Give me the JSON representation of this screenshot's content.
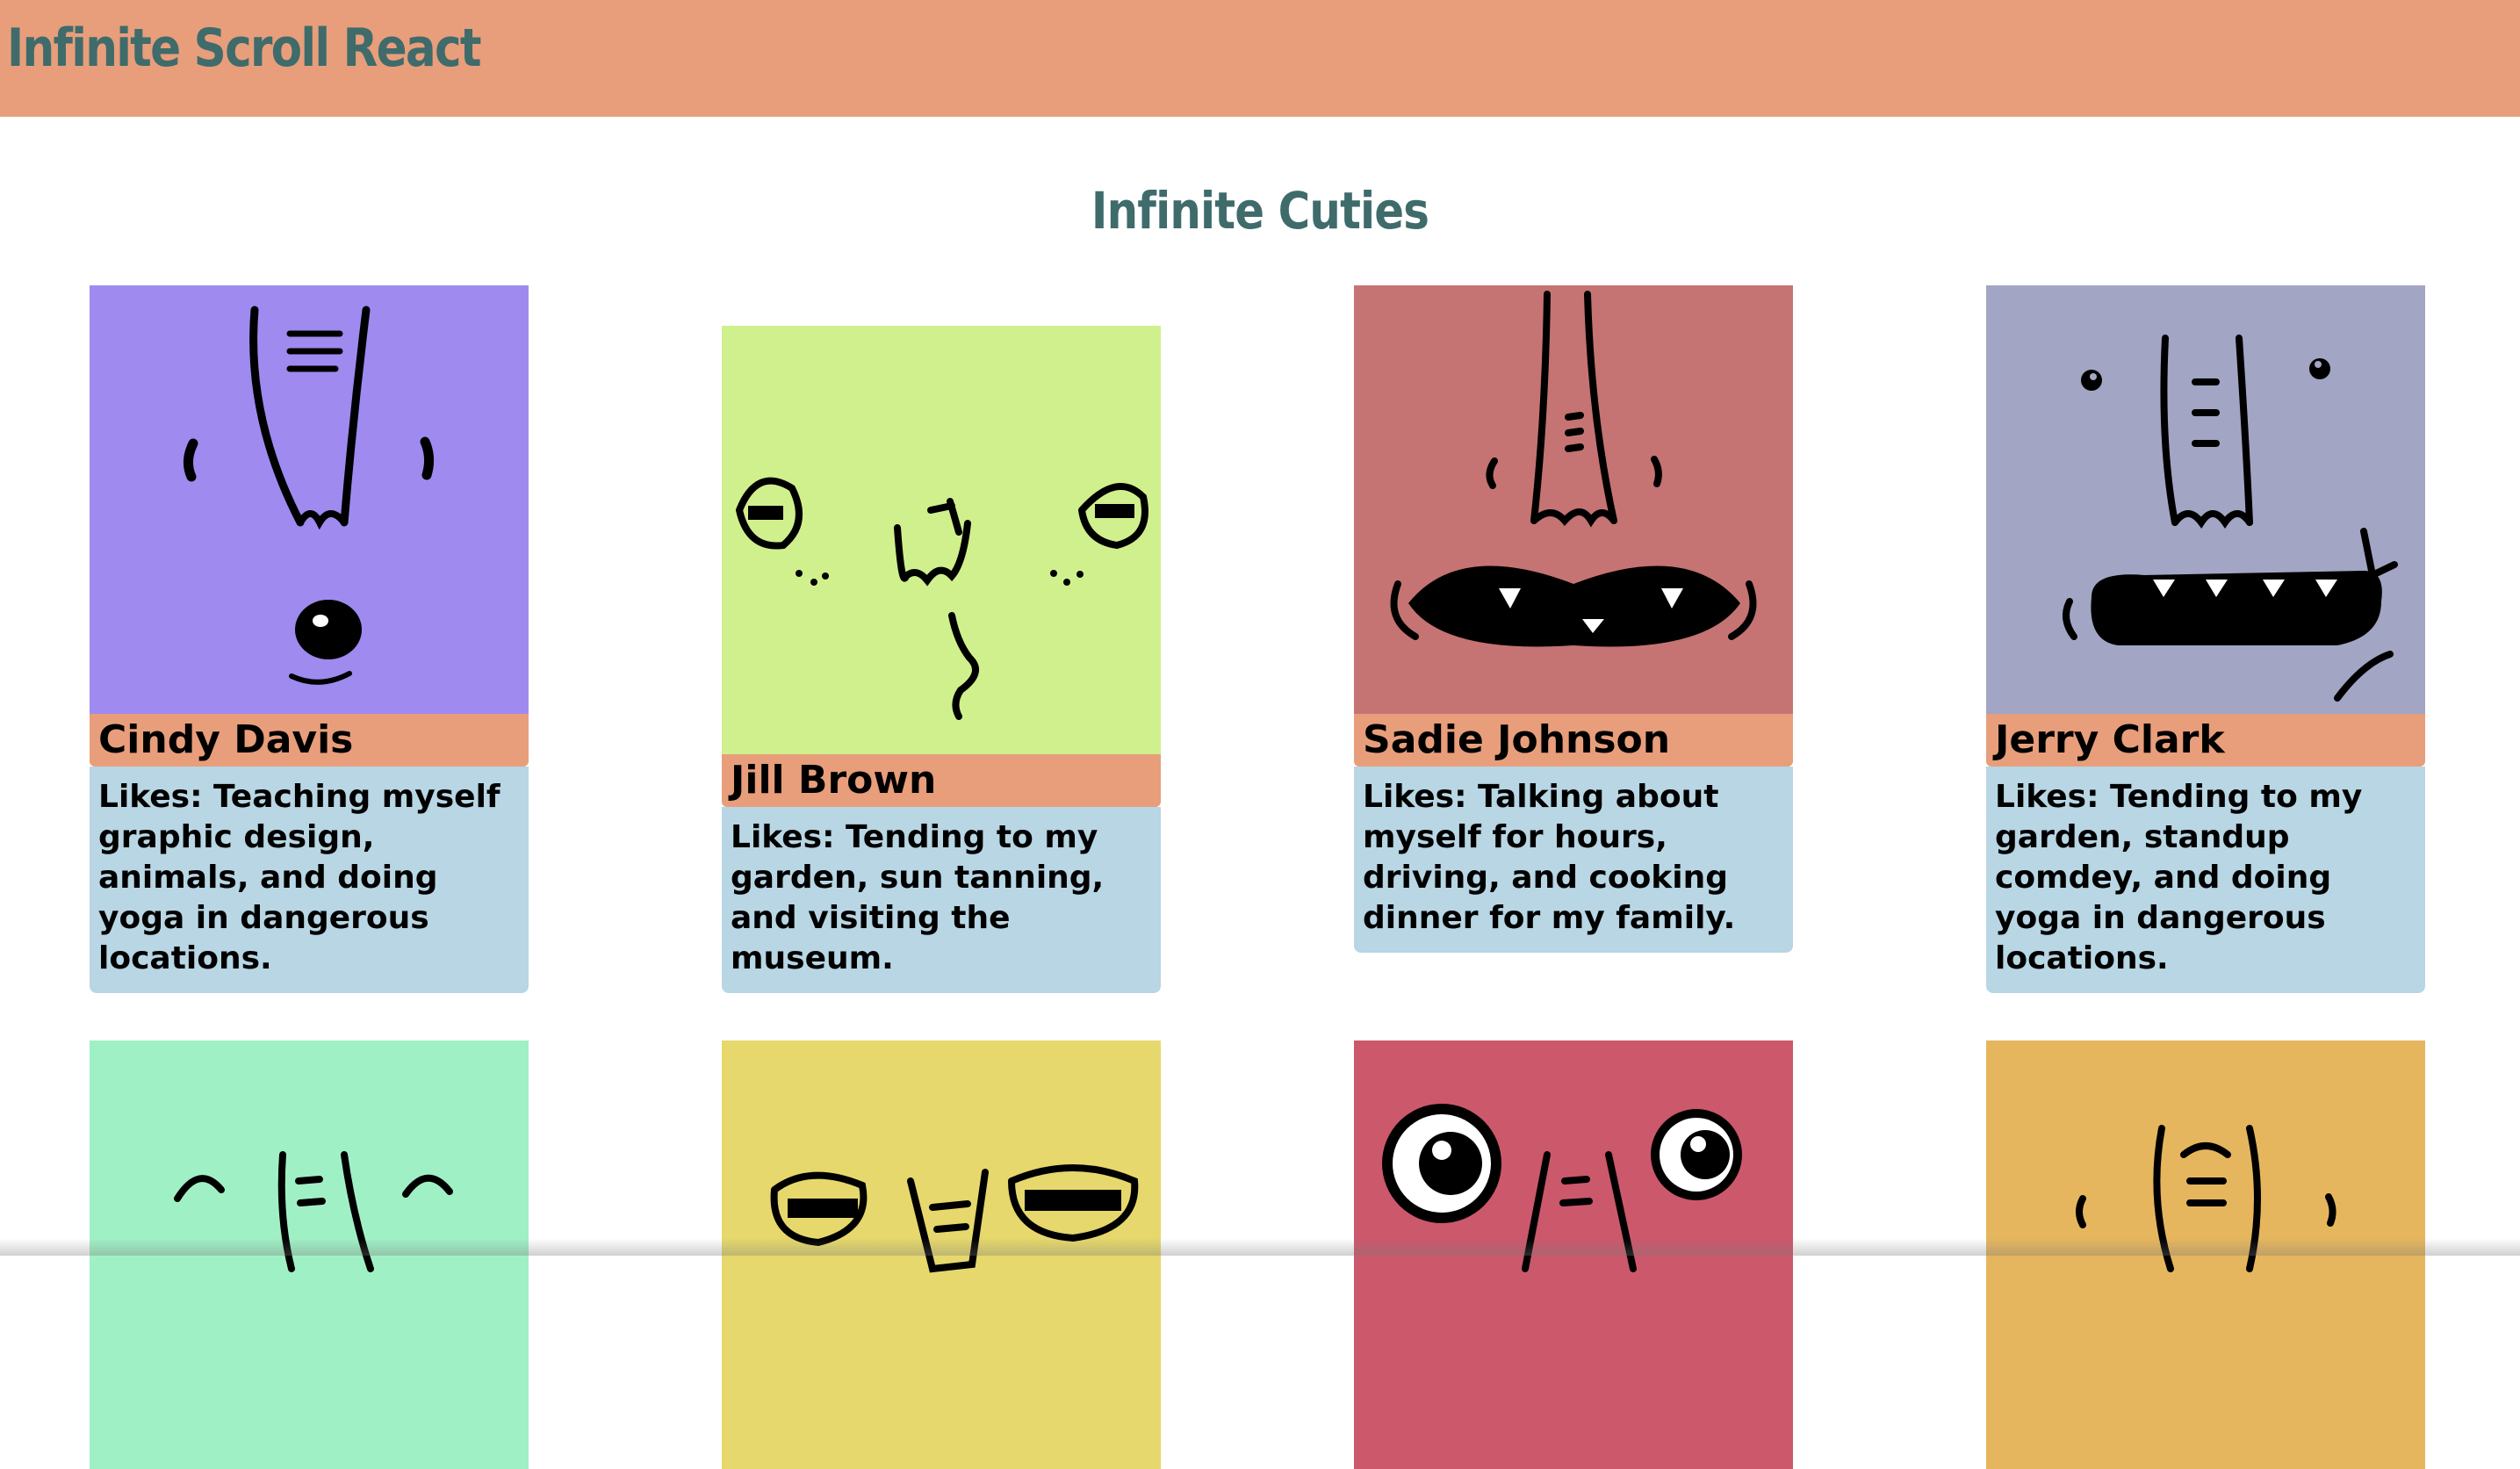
{
  "app": {
    "title": "Infinite Scroll React"
  },
  "page": {
    "heading": "Infinite Cuties"
  },
  "cards": [
    {
      "name": "Cindy Davis",
      "likes": "Likes: Teaching myself graphic design, animals, and doing yoga in dangerous locations.",
      "color": "#9f8af0",
      "face": "elephant-face-icon"
    },
    {
      "name": "Jill Brown",
      "likes": "Likes: Tending to my garden, sun tanning, and visiting the museum.",
      "color": "#cff08c",
      "face": "goggle-face-icon"
    },
    {
      "name": "Sadie Johnson",
      "likes": "Likes: Talking about myself for hours, driving, and cooking dinner for my family.",
      "color": "#c67373",
      "face": "grin-face-icon"
    },
    {
      "name": "Jerry Clark",
      "likes": "Likes: Tending to my garden, standup comdey, and doing yoga in dangerous locations.",
      "color": "#a2a5c3",
      "face": "toothy-face-icon"
    },
    {
      "name": "",
      "likes": "",
      "color": "#a0f0c6",
      "face": "sleepy-face-icon"
    },
    {
      "name": "",
      "likes": "",
      "color": "#e6d86c",
      "face": "goggle-face-icon"
    },
    {
      "name": "",
      "likes": "",
      "color": "#cc586c",
      "face": "bug-eye-face-icon"
    },
    {
      "name": "",
      "likes": "",
      "color": "#e6b65e",
      "face": "elephant-face-icon"
    }
  ]
}
